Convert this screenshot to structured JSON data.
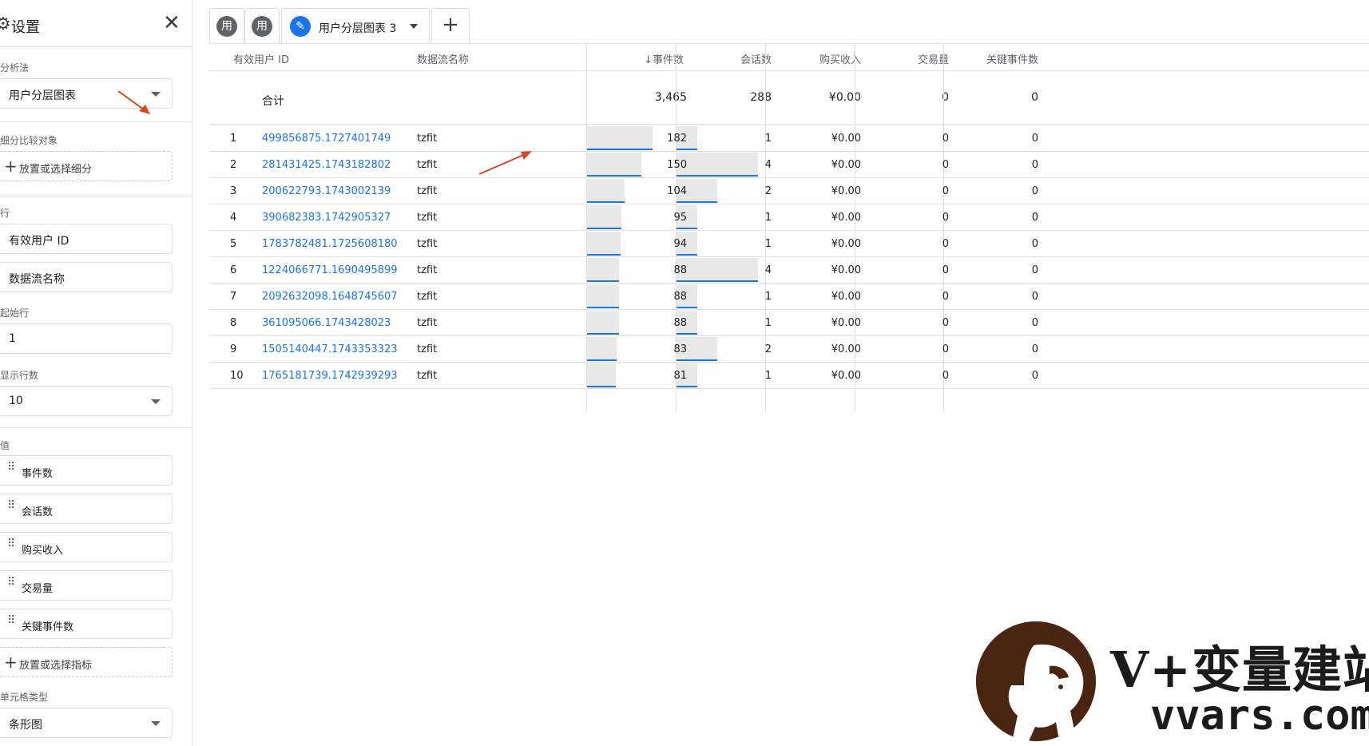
{
  "settings": {
    "title": "设置",
    "analysis_method_label": "分析法",
    "analysis_method_value": "用户分层图表",
    "segment_compare_label": "细分比较对象",
    "segment_add": "放置或选择细分",
    "rows_label": "行",
    "rows": [
      "有效用户 ID",
      "数据流名称"
    ],
    "start_row_label": "起始行",
    "start_row_value": "1",
    "show_rows_label": "显示行数",
    "show_rows_value": "10",
    "values_label": "值",
    "values": [
      "事件数",
      "会话数",
      "购买收入",
      "交易量",
      "关键事件数"
    ],
    "metric_add": "放置或选择指标",
    "cell_type_label": "单元格类型",
    "cell_type_value": "条形图"
  },
  "tabs": {
    "tab1": "用",
    "tab2": "用",
    "active": "用户分层图表 3",
    "add": "+"
  },
  "table": {
    "headers": [
      "有效用户 ID",
      "数据流名称",
      "事件数",
      "会话数",
      "购买收入",
      "交易量",
      "关键事件数"
    ],
    "sort_indicator": "↓",
    "total_label": "合计",
    "totals": [
      "3,465",
      "288",
      "¥0.00",
      "0",
      "0"
    ],
    "rows": [
      {
        "n": "1",
        "id": "499856875.1727401749",
        "stream": "tzfit",
        "events": "182",
        "sessions": "1",
        "revenue": "¥0.00",
        "tx": "0",
        "key": "0"
      },
      {
        "n": "2",
        "id": "281431425.1743182802",
        "stream": "tzfit",
        "events": "150",
        "sessions": "4",
        "revenue": "¥0.00",
        "tx": "0",
        "key": "0"
      },
      {
        "n": "3",
        "id": "200622793.1743002139",
        "stream": "tzfit",
        "events": "104",
        "sessions": "2",
        "revenue": "¥0.00",
        "tx": "0",
        "key": "0"
      },
      {
        "n": "4",
        "id": "390682383.1742905327",
        "stream": "tzfit",
        "events": "95",
        "sessions": "1",
        "revenue": "¥0.00",
        "tx": "0",
        "key": "0"
      },
      {
        "n": "5",
        "id": "1783782481.1725608180",
        "stream": "tzfit",
        "events": "94",
        "sessions": "1",
        "revenue": "¥0.00",
        "tx": "0",
        "key": "0"
      },
      {
        "n": "6",
        "id": "1224066771.1690495899",
        "stream": "tzfit",
        "events": "88",
        "sessions": "4",
        "revenue": "¥0.00",
        "tx": "0",
        "key": "0"
      },
      {
        "n": "7",
        "id": "2092632098.1648745607",
        "stream": "tzfit",
        "events": "88",
        "sessions": "1",
        "revenue": "¥0.00",
        "tx": "0",
        "key": "0"
      },
      {
        "n": "8",
        "id": "361095066.1743428023",
        "stream": "tzfit",
        "events": "88",
        "sessions": "1",
        "revenue": "¥0.00",
        "tx": "0",
        "key": "0"
      },
      {
        "n": "9",
        "id": "1505140447.1743353323",
        "stream": "tzfit",
        "events": "83",
        "sessions": "2",
        "revenue": "¥0.00",
        "tx": "0",
        "key": "0"
      },
      {
        "n": "10",
        "id": "1765181739.1742939293",
        "stream": "tzfit",
        "events": "81",
        "sessions": "1",
        "revenue": "¥0.00",
        "tx": "0",
        "key": "0"
      }
    ]
  },
  "watermark": {
    "text": "V+变量建站",
    "url": "vvars.com"
  },
  "colors": {
    "link": "#1a73e8",
    "bar": "#e8e8e8",
    "bar_line": "#1a73e8",
    "annotation_arrow": "#d9481f"
  }
}
